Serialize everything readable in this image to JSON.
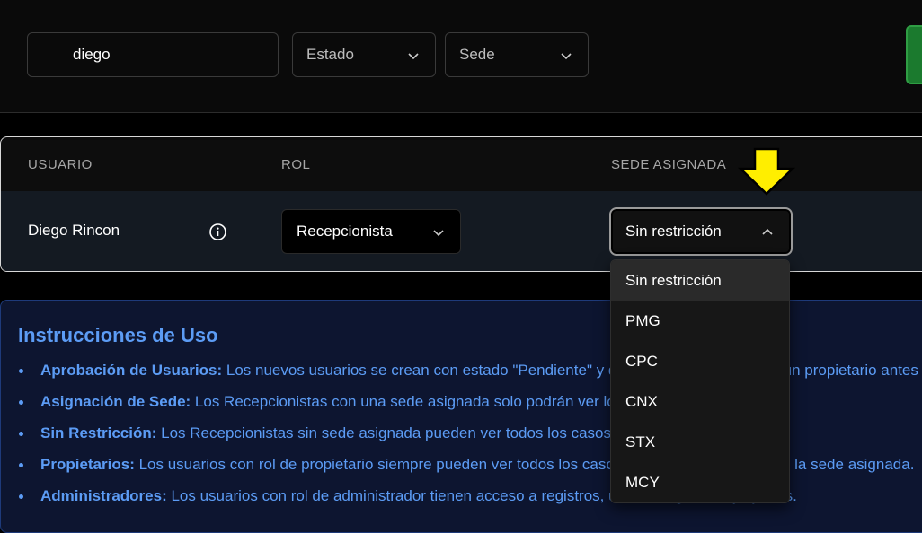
{
  "filters": {
    "search_value": "diego",
    "estado_placeholder": "Estado",
    "sede_placeholder": "Sede"
  },
  "table": {
    "headers": [
      "USUARIO",
      "ROL",
      "SEDE ASIGNADA"
    ],
    "rows": [
      {
        "usuario": "Diego Rincon",
        "rol": "Recepcionista",
        "sede": "Sin restricción"
      }
    ]
  },
  "dropdown": {
    "options": [
      "Sin restricción",
      "PMG",
      "CPC",
      "CNX",
      "STX",
      "MCY"
    ],
    "selected": "Sin restricción"
  },
  "instructions": {
    "title": "Instrucciones de Uso",
    "items": [
      {
        "label": "Aprobación de Usuarios:",
        "text": " Los nuevos usuarios se crean con estado \"Pendiente\" y deben ser aprobados por un propietario antes"
      },
      {
        "label": "Asignación de Sede:",
        "text": " Los Recepcionistas con una sede asignada solo podrán ver los casos de esa sede."
      },
      {
        "label": "Sin Restricción:",
        "text": " Los Recepcionistas sin sede asignada pueden ver todos los casos."
      },
      {
        "label": "Propietarios:",
        "text": " Los usuarios con rol de propietario siempre pueden ver todos los casos, independientemente de la sede asignada."
      },
      {
        "label": "Administradores:",
        "text": " Los usuarios con rol de administrador tienen acceso a registros, usuarios, gráficos y ajustes."
      }
    ]
  },
  "colors": {
    "accent_blue": "#5c9cf5",
    "green_button": "#1b7a2e",
    "annotation_arrow": "#ffee00"
  }
}
